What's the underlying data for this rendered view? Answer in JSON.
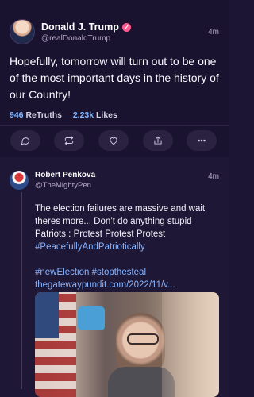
{
  "post": {
    "author_name": "Donald J. Trump",
    "verified_icon": "verified-badge-icon",
    "handle": "@realDonaldTrump",
    "time": "4m",
    "text": "Hopefully, tomorrow will turn out to be one of the most important days in the history of our Country!",
    "stats": {
      "retruths_count": "946",
      "retruths_label": "ReTruths",
      "likes_count": "2.23k",
      "likes_label": "Likes"
    },
    "actions": [
      {
        "name": "reply",
        "icon": "reply-bubble-icon"
      },
      {
        "name": "retruth",
        "icon": "retruth-icon"
      },
      {
        "name": "like",
        "icon": "heart-icon"
      },
      {
        "name": "share",
        "icon": "share-icon"
      },
      {
        "name": "more",
        "icon": "more-dots-icon"
      }
    ]
  },
  "reply": {
    "author_name": "Robert Penkova",
    "handle": "@TheMightyPen",
    "time": "4m",
    "lines": [
      "The election failures are massive and wait",
      "theres more... Don’t do anything stupid",
      "Patriots : Protest Protest Protest",
      "#PeacefullyAndPatriotically",
      "",
      "#newElection #stopthesteal",
      "thegatewaypundit.com/2022/11/v..."
    ],
    "media": "video-thumbnail"
  },
  "colors": {
    "background": "#1c1534",
    "accent_blue": "#85b7ff",
    "hashtag_blue": "#89b4ff",
    "verified_pink": "#ff5a91"
  }
}
